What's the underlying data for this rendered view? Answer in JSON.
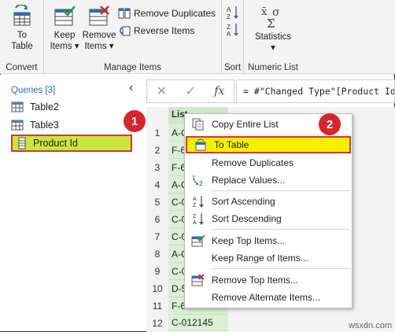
{
  "ribbon": {
    "convert": {
      "to_table": "To\nTable",
      "label": "Convert"
    },
    "manage": {
      "keep_items": "Keep\nItems ▾",
      "remove_items": "Remove\nItems ▾",
      "remove_duplicates": "Remove Duplicates",
      "reverse_items": "Reverse Items",
      "label": "Manage Items"
    },
    "sort": {
      "label": "Sort"
    },
    "numeric": {
      "statistics": "Statistics",
      "statistics_arrow": "▾",
      "label": "Numeric List"
    }
  },
  "queries": {
    "header": "Queries [3]",
    "collapse": "‹",
    "items": [
      {
        "label": "Table2"
      },
      {
        "label": "Table3"
      },
      {
        "label": "Product Id"
      }
    ]
  },
  "callouts": {
    "one": "1",
    "two": "2"
  },
  "formula": {
    "cancel": "✕",
    "confirm": "✓",
    "fx": "fx",
    "text": "= #\"Changed Type\"[Product Id]"
  },
  "grid": {
    "column_header": "List",
    "rows": [
      {
        "n": "1",
        "v": "A-C"
      },
      {
        "n": "2",
        "v": "F-6"
      },
      {
        "n": "3",
        "v": "F-6"
      },
      {
        "n": "4",
        "v": "A-C"
      },
      {
        "n": "5",
        "v": "C-0"
      },
      {
        "n": "6",
        "v": "C-0"
      },
      {
        "n": "7",
        "v": "C-0"
      },
      {
        "n": "8",
        "v": "A-C"
      },
      {
        "n": "9",
        "v": "C-0"
      },
      {
        "n": "10",
        "v": "D-5"
      },
      {
        "n": "11",
        "v": "F-6"
      },
      {
        "n": "12",
        "v": "C-012145"
      }
    ]
  },
  "menu": {
    "copy_entire_list": "Copy Entire List",
    "to_table": "To Table",
    "remove_duplicates": "Remove Duplicates",
    "replace_values": "Replace Values...",
    "sort_ascending": "Sort Ascending",
    "sort_descending": "Sort Descending",
    "keep_top_items": "Keep Top Items...",
    "keep_range_of_items": "Keep Range of Items...",
    "remove_top_items": "Remove Top Items...",
    "remove_alternate_items": "Remove Alternate Items..."
  },
  "watermark": "wsxdn.com",
  "colors": {
    "highlight": "#f2f200",
    "query_selected": "#c8e63c",
    "callout": "#d5262d",
    "list_cells": "#d9f0d5"
  }
}
